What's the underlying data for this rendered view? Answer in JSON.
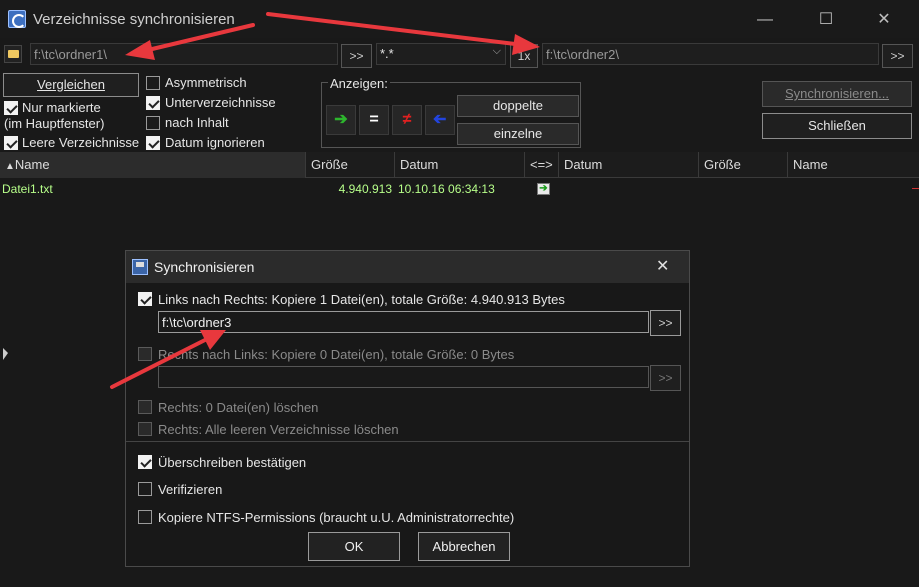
{
  "window": {
    "title": "Verzeichnisse synchronisieren",
    "controls": {
      "minimize": "—",
      "maximize": "☐",
      "close": "✕"
    }
  },
  "paths": {
    "left": "f:\\tc\\ordner1\\",
    "left_browse": ">>",
    "filter": "*.*",
    "one_x": "1x",
    "right": "f:\\tc\\ordner2\\",
    "right_browse": ">>"
  },
  "options": {
    "compare_button": "Vergleichen",
    "only_marked_line1": "Nur markierte",
    "only_marked_line2": "(im Hauptfenster)",
    "empty_dirs": "Leere Verzeichnisse",
    "asymmetric": "Asymmetrisch",
    "subdirs": "Unterverzeichnisse",
    "by_content": "nach Inhalt",
    "ignore_date": "Datum ignorieren",
    "show_label": "Anzeigen:",
    "filter_equal": "=",
    "filter_unequal": "≠",
    "duplicates_button": "doppelte",
    "singles_button": "einzelne",
    "sync_button": "Synchronisieren...",
    "close_button": "Schließen"
  },
  "columns": {
    "name_left": "Name",
    "size_left": "Größe",
    "date_left": "Datum",
    "direction": "<=>",
    "date_right": "Datum",
    "size_right": "Größe",
    "name_right": "Name"
  },
  "rows": [
    {
      "name": "Datei1.txt",
      "size": "4.940.913",
      "date": "10.10.16 06:34:13",
      "direction_icon": "arrow-right-icon"
    }
  ],
  "dialog": {
    "title": "Synchronisieren",
    "close": "✕",
    "ltr_label": "Links nach Rechts: Kopiere 1 Datei(en), totale Größe: 4.940.913 Bytes",
    "ltr_target": "f:\\tc\\ordner3",
    "ltr_browse": ">>",
    "rtl_label": "Rechts nach Links: Kopiere 0 Datei(en), totale Größe: 0 Bytes",
    "rtl_target": "",
    "rtl_browse": ">>",
    "delete_right": "Rechts: 0 Datei(en) löschen",
    "delete_empty_right": "Rechts: Alle leeren Verzeichnisse löschen",
    "confirm_overwrite": "Überschreiben bestätigen",
    "verify": "Verifizieren",
    "copy_ntfs": "Kopiere NTFS-Permissions (braucht u.U. Administratorrechte)",
    "ok": "OK",
    "cancel": "Abbrechen"
  },
  "colors": {
    "annotation_arrow": "#e8383d",
    "file_text": "#b7ff8a",
    "green_arrow": "#2db52d",
    "red_unequal": "#e02020",
    "blue_arrow": "#2244dd"
  }
}
